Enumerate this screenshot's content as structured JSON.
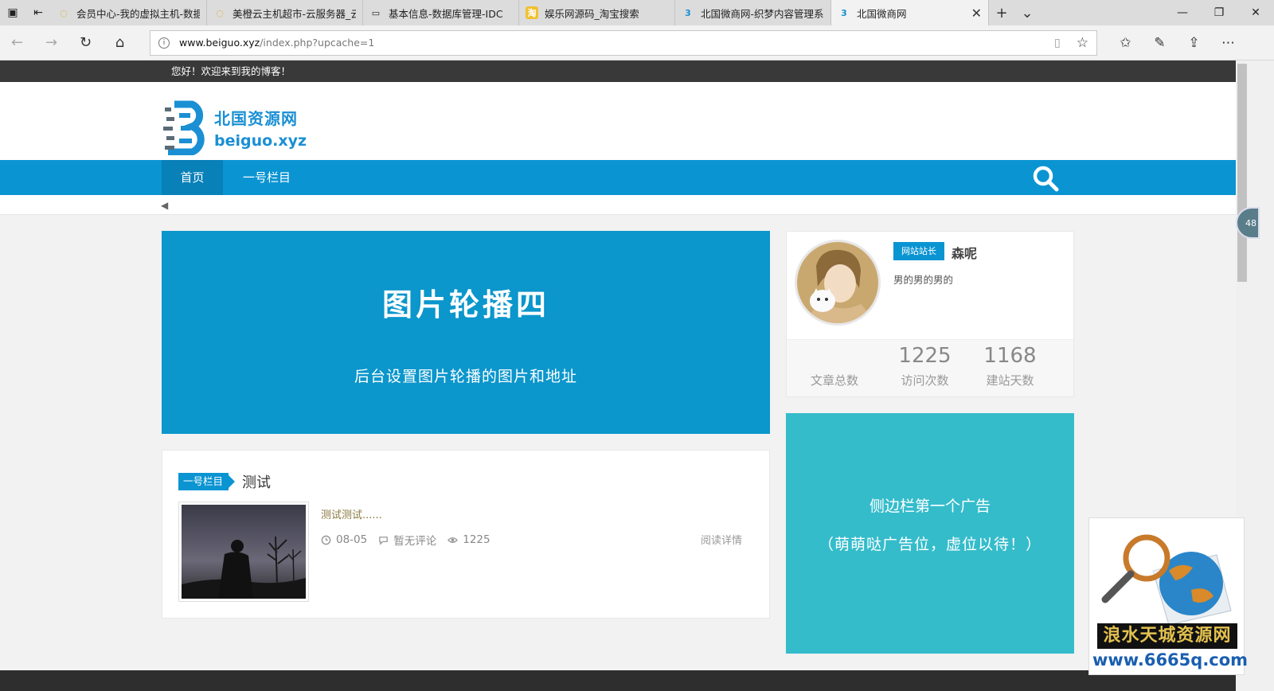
{
  "browser": {
    "tabs": [
      {
        "title": "会员中心-我的虚拟主机-数据",
        "active": false
      },
      {
        "title": "美橙云主机超市-云服务器_云",
        "active": false
      },
      {
        "title": "基本信息-数据库管理-IDC",
        "active": false
      },
      {
        "title": "娱乐网源码_淘宝搜索",
        "active": false
      },
      {
        "title": "北国微商网-织梦内容管理系",
        "active": false
      },
      {
        "title": "北国微商网",
        "active": true
      }
    ],
    "url_host": "www.beiguo.xyz",
    "url_path": "/index.php?upcache=1"
  },
  "site": {
    "welcome": "您好！欢迎来到我的博客！",
    "logo_cn": "北国资源网",
    "logo_en": "beiguo.xyz",
    "nav": [
      {
        "label": "首页"
      },
      {
        "label": "一号栏目"
      }
    ]
  },
  "slider": {
    "title": "图片轮播四",
    "subtitle": "后台设置图片轮播的图片和地址"
  },
  "post": {
    "category": "一号栏目",
    "title": "测试",
    "excerpt": "测试测试......",
    "date": "08-05",
    "comments": "暂无评论",
    "views": "1225",
    "read_more": "阅读详情"
  },
  "author": {
    "role": "网站站长",
    "name": "森呢",
    "bio": "男的男的男的",
    "stats": [
      {
        "value": "",
        "label": "文章总数"
      },
      {
        "value": "1225",
        "label": "访问次数"
      },
      {
        "value": "1168",
        "label": "建站天数"
      }
    ]
  },
  "ad": {
    "line1": "侧边栏第一个广告",
    "line2": "（萌萌哒广告位，虚位以待！）"
  },
  "side_badge": "48",
  "watermark": {
    "cn": "浪水天城资源网",
    "en": "www.6665q.com"
  },
  "colors": {
    "primary": "#0a94d2",
    "ad": "#35bccb",
    "topbar": "#393939"
  }
}
